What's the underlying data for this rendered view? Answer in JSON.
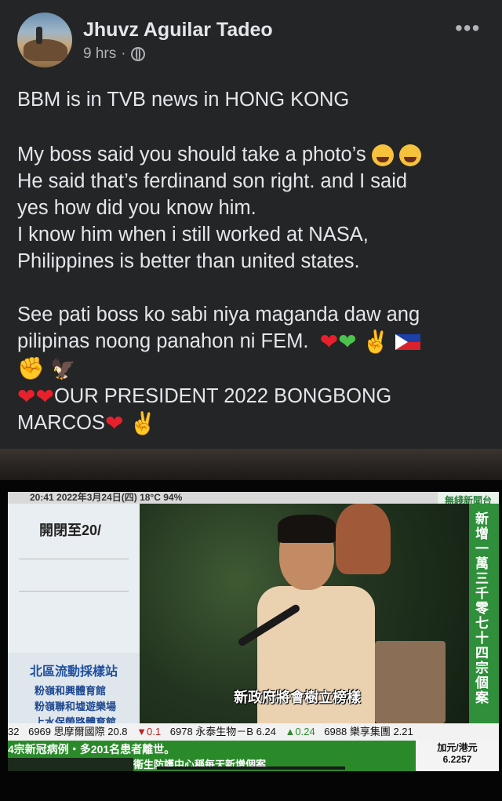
{
  "post": {
    "author": "Jhuvz Aguilar Tadeo",
    "time": "9 hrs",
    "separator": "·",
    "more": "•••",
    "lines": [
      "BBM is in TVB news in HONG KONG",
      "My boss said you should take a photo’s",
      "He said that’s ferdinand son right. and I said",
      "yes how did you know him.",
      "I know him when i still worked at NASA,",
      "Philippines is better than united states.",
      "See pati boss ko sabi niya maganda daw ang",
      "pilipinas noong panahon ni FEM.",
      "OUR PRESIDENT 2022 BONGBONG",
      "MARCOS"
    ],
    "emoji": {
      "heart": "❤",
      "peace": "✌",
      "fist": "✊",
      "eagle": "🦅"
    },
    "icons": [
      "globe-icon",
      "more-options-icon",
      "hug-face-icon",
      "grin-sweat-icon",
      "philippine-flag-icon"
    ]
  },
  "tv": {
    "date_line": "20:41  2022年3月24日(四)  18°C  94%",
    "left_title": "開閉至20/",
    "left_heading": "北區流動採樣站",
    "left_items": [
      "粉嶺和興體育館",
      "粉嶺聯和墟遊樂場",
      "上水保榮路體育館"
    ],
    "subtitle": "新政府將會樹立榜樣",
    "vertical_text": "新增一萬三千零七十四宗個案",
    "channel_logo": "無綫新聞台",
    "stocks": [
      {
        "text": "32",
        "dir": ""
      },
      {
        "text": "6969 思摩爾國際 20.8",
        "dir": ""
      },
      {
        "text": "▼0.1",
        "dir": "down"
      },
      {
        "text": "6978 永泰生物－B 6.24",
        "dir": ""
      },
      {
        "text": "▲0.24",
        "dir": "up"
      },
      {
        "text": "6988 樂享集團 2.21",
        "dir": ""
      }
    ],
    "ticker": "4宗新冠病例・多201名患者離世。",
    "ticker2": "衞生防護中心稱每天新增個案",
    "fx_label": "加元/港元",
    "fx_value": "6.2257"
  }
}
